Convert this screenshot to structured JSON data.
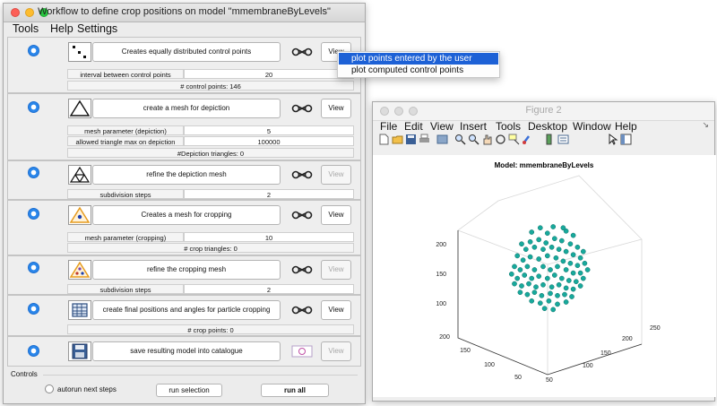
{
  "workflow": {
    "title": "Workflow to define crop positions on model \"mmembraneByLevels\"",
    "menu": [
      "Tools",
      "Help",
      "Settings"
    ],
    "steps": [
      {
        "action": "Creates equally distributed control points",
        "view": "View",
        "view_enabled": true,
        "icon": "distributed-points-icon",
        "params": [
          {
            "label": "interval between control points",
            "value": "20"
          }
        ],
        "info": "# control points: 146"
      },
      {
        "action": "create a mesh  for depiction",
        "view": "View",
        "view_enabled": true,
        "icon": "triangle-mesh-icon",
        "params": [
          {
            "label": "mesh parameter (depiction)",
            "value": "5"
          },
          {
            "label": "allowed triangle max on depiction",
            "value": "100000"
          }
        ],
        "info": "#Depiction triangles: 0"
      },
      {
        "action": "refine the depiction mesh",
        "view": "View",
        "view_enabled": false,
        "icon": "refined-triangle-icon",
        "params": [
          {
            "label": "subdivision steps",
            "value": "2"
          }
        ],
        "info": ""
      },
      {
        "action": "Creates a mesh for cropping",
        "view": "View",
        "view_enabled": true,
        "icon": "crop-triangle-icon",
        "params": [
          {
            "label": "mesh parameter (cropping)",
            "value": "10"
          }
        ],
        "info": "# crop triangles: 0"
      },
      {
        "action": "refine the cropping mesh",
        "view": "View",
        "view_enabled": false,
        "icon": "refined-crop-triangle-icon",
        "params": [
          {
            "label": "subdivision steps",
            "value": "2"
          }
        ],
        "info": ""
      },
      {
        "action": "create final positions and angles for particle cropping",
        "view": "View",
        "view_enabled": true,
        "icon": "table-icon",
        "params": [],
        "info": "# crop points: 0"
      },
      {
        "action": "save resulting model into catalogue",
        "view": "View",
        "view_enabled": false,
        "icon": "save-disk-icon",
        "params": [],
        "info": ""
      }
    ],
    "controls": {
      "label": "Controls",
      "autorun": "autorun next steps",
      "run_selection": "run selection",
      "run_all": "run all"
    }
  },
  "dropdown": {
    "items": [
      "plot points entered by the user",
      "plot computed control points"
    ],
    "selected_index": 0
  },
  "figure": {
    "title": "Figure 2",
    "menu": [
      "File",
      "Edit",
      "View",
      "Insert",
      "Tools",
      "Desktop",
      "Window",
      "Help"
    ],
    "toolbar_icons": [
      "new-figure-icon",
      "open-file-icon",
      "save-icon",
      "print-icon",
      "link-plot-icon",
      "zoom-in-icon",
      "zoom-out-icon",
      "pan-icon",
      "rotate-3d-icon",
      "data-cursor-icon",
      "brush-icon",
      "colorbar-icon",
      "legend-icon",
      "edit-plot-icon",
      "property-inspector-icon"
    ]
  },
  "chart_data": {
    "type": "scatter",
    "title": "Model: mmembraneByLevels",
    "projection": "3d",
    "marker_color": "#18a99c",
    "z_ticks": [
      "100",
      "150",
      "200"
    ],
    "x_ticks": [
      "50",
      "100",
      "150",
      "200"
    ],
    "y_ticks": [
      "50",
      "100",
      "150",
      "200",
      "250"
    ],
    "points": [
      [
        0.37,
        0.2
      ],
      [
        0.43,
        0.16
      ],
      [
        0.52,
        0.15
      ],
      [
        0.61,
        0.19
      ],
      [
        0.66,
        0.23
      ],
      [
        0.59,
        0.16
      ],
      [
        0.48,
        0.21
      ],
      [
        0.3,
        0.31
      ],
      [
        0.36,
        0.29
      ],
      [
        0.42,
        0.27
      ],
      [
        0.47,
        0.3
      ],
      [
        0.53,
        0.26
      ],
      [
        0.58,
        0.28
      ],
      [
        0.64,
        0.31
      ],
      [
        0.69,
        0.34
      ],
      [
        0.73,
        0.38
      ],
      [
        0.33,
        0.36
      ],
      [
        0.39,
        0.34
      ],
      [
        0.45,
        0.36
      ],
      [
        0.51,
        0.34
      ],
      [
        0.56,
        0.36
      ],
      [
        0.61,
        0.38
      ],
      [
        0.66,
        0.41
      ],
      [
        0.71,
        0.44
      ],
      [
        0.27,
        0.42
      ],
      [
        0.31,
        0.46
      ],
      [
        0.36,
        0.43
      ],
      [
        0.42,
        0.45
      ],
      [
        0.48,
        0.42
      ],
      [
        0.54,
        0.44
      ],
      [
        0.59,
        0.47
      ],
      [
        0.64,
        0.49
      ],
      [
        0.69,
        0.51
      ],
      [
        0.74,
        0.49
      ],
      [
        0.25,
        0.52
      ],
      [
        0.29,
        0.55
      ],
      [
        0.34,
        0.52
      ],
      [
        0.39,
        0.55
      ],
      [
        0.45,
        0.52
      ],
      [
        0.5,
        0.55
      ],
      [
        0.55,
        0.52
      ],
      [
        0.61,
        0.55
      ],
      [
        0.66,
        0.58
      ],
      [
        0.71,
        0.58
      ],
      [
        0.76,
        0.55
      ],
      [
        0.23,
        0.59
      ],
      [
        0.27,
        0.63
      ],
      [
        0.32,
        0.6
      ],
      [
        0.37,
        0.63
      ],
      [
        0.42,
        0.61
      ],
      [
        0.48,
        0.63
      ],
      [
        0.53,
        0.6
      ],
      [
        0.58,
        0.63
      ],
      [
        0.63,
        0.65
      ],
      [
        0.68,
        0.66
      ],
      [
        0.73,
        0.63
      ],
      [
        0.25,
        0.68
      ],
      [
        0.3,
        0.7
      ],
      [
        0.35,
        0.68
      ],
      [
        0.4,
        0.71
      ],
      [
        0.45,
        0.69
      ],
      [
        0.51,
        0.71
      ],
      [
        0.56,
        0.69
      ],
      [
        0.61,
        0.72
      ],
      [
        0.66,
        0.73
      ],
      [
        0.71,
        0.7
      ],
      [
        0.29,
        0.76
      ],
      [
        0.34,
        0.78
      ],
      [
        0.39,
        0.76
      ],
      [
        0.44,
        0.79
      ],
      [
        0.5,
        0.77
      ],
      [
        0.55,
        0.79
      ],
      [
        0.6,
        0.78
      ],
      [
        0.65,
        0.8
      ],
      [
        0.37,
        0.84
      ],
      [
        0.43,
        0.86
      ],
      [
        0.49,
        0.84
      ],
      [
        0.55,
        0.87
      ],
      [
        0.61,
        0.85
      ],
      [
        0.46,
        0.91
      ],
      [
        0.52,
        0.92
      ]
    ]
  }
}
